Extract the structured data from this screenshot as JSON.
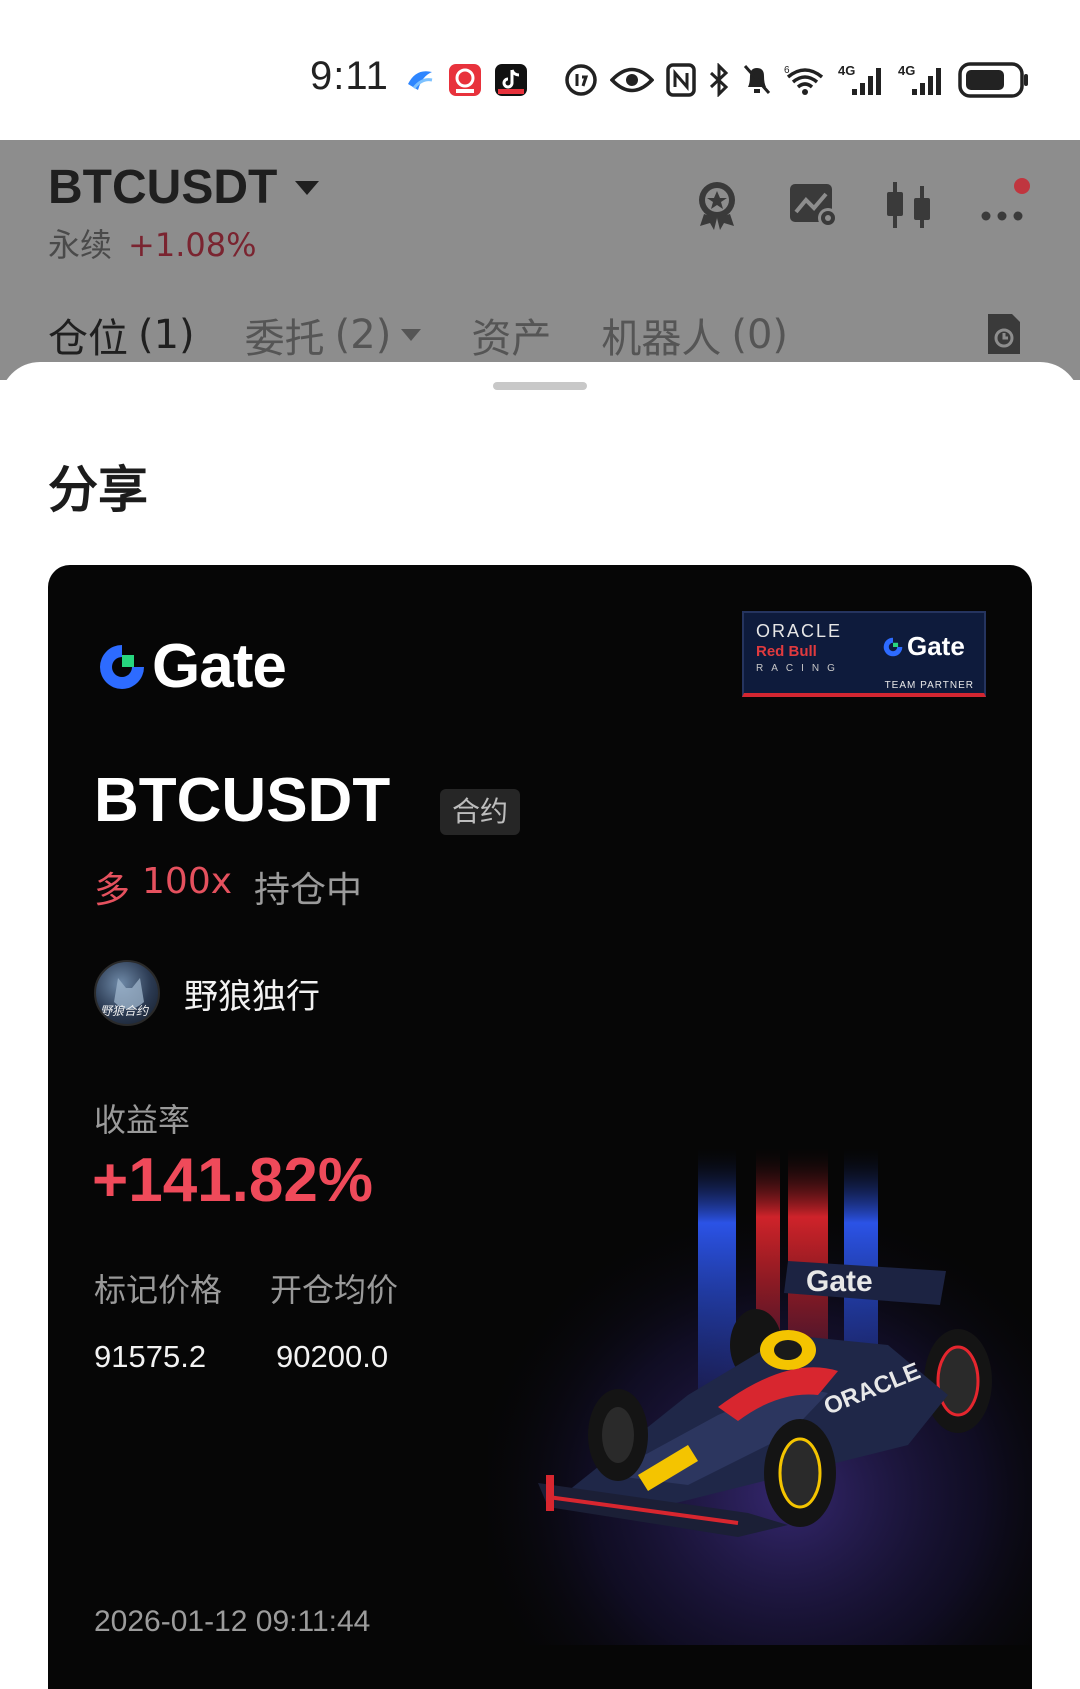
{
  "status_bar": {
    "time": "9:11",
    "icons": [
      "app-notification-icon",
      "app-notification-icon",
      "tiktok-icon",
      "data-saver-icon",
      "eye-icon",
      "nfc-icon",
      "bluetooth-icon",
      "mute-icon",
      "wifi-icon",
      "signal-4g-icon",
      "signal-4g-icon",
      "battery-icon"
    ],
    "network_label_1": "4G",
    "network_label_2": "4G",
    "wifi_label": "6"
  },
  "header": {
    "symbol": "BTCUSDT",
    "contract_type": "永续",
    "change": "+1.08%",
    "icons": [
      "badge-icon",
      "chart-settings-icon",
      "candlestick-icon",
      "more-icon"
    ]
  },
  "tabs": [
    {
      "label": "仓位",
      "count": "(1)"
    },
    {
      "label": "委托",
      "count": "(2)"
    },
    {
      "label": "资产",
      "count": ""
    },
    {
      "label": "机器人",
      "count": "(0)"
    }
  ],
  "sheet": {
    "title": "分享"
  },
  "card": {
    "brand": "Gate",
    "partner": {
      "line1": "ORACLE",
      "line2": "Red Bull",
      "line3": "RACING",
      "brand": "Gate",
      "tag": "TEAM PARTNER"
    },
    "symbol": "BTCUSDT",
    "contract_tag": "合约",
    "side": "多",
    "leverage": "100x",
    "status": "持仓中",
    "username": "野狼独行",
    "avatar_text": "野狼合约",
    "yield_label": "收益率",
    "yield_value": "+141.82%",
    "mark_price_label": "标记价格",
    "entry_price_label": "开仓均价",
    "mark_price": "91575.2",
    "entry_price": "90200.0",
    "timestamp": "2026-01-12 09:11:44"
  },
  "colors": {
    "accent_red": "#ef4a5a",
    "gate_blue": "#2d6bff",
    "gate_green": "#27d67f",
    "card_bg": "#060606"
  }
}
